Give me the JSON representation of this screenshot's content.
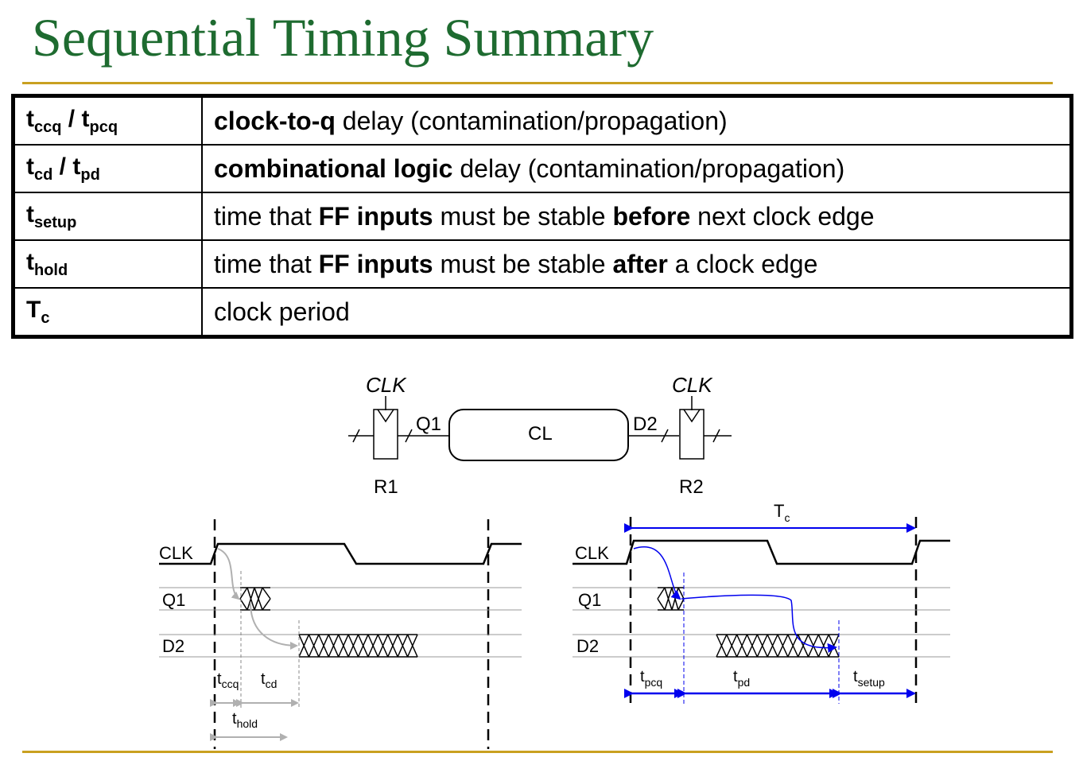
{
  "title": "Sequential Timing Summary",
  "table": {
    "rows": [
      {
        "sym1": "t",
        "sub1": "ccq",
        "sep": " / ",
        "sym2": "t",
        "sub2": "pcq",
        "d1": "",
        "b1": "clock-to-q",
        "d2": " delay (contamination/propagation)",
        "b2": "",
        "d3": ""
      },
      {
        "sym1": "t",
        "sub1": "cd",
        "sep": " / ",
        "sym2": "t",
        "sub2": "pd",
        "d1": "",
        "b1": "combinational logic",
        "d2": " delay (contamination/propagation)",
        "b2": "",
        "d3": ""
      },
      {
        "sym1": "t",
        "sub1": "setup",
        "sep": "",
        "sym2": "",
        "sub2": "",
        "d1": "time that ",
        "b1": "FF inputs",
        "d2": " must be stable ",
        "b2": "before",
        "d3": " next clock edge"
      },
      {
        "sym1": "t",
        "sub1": "hold",
        "sep": "",
        "sym2": "",
        "sub2": "",
        "d1": "time that ",
        "b1": "FF inputs",
        "d2": " must be stable ",
        "b2": "after",
        "d3": " a clock edge"
      },
      {
        "sym1": "T",
        "sub1": "c",
        "sep": "",
        "sym2": "",
        "sub2": "",
        "d1": "clock period",
        "b1": "",
        "d2": "",
        "b2": "",
        "d3": ""
      }
    ]
  },
  "circuit": {
    "clk_left": "CLK",
    "clk_right": "CLK",
    "q1": "Q1",
    "d2": "D2",
    "cl": "CL",
    "r1": "R1",
    "r2": "R2"
  },
  "timing_left": {
    "signals": [
      "CLK",
      "Q1",
      "D2"
    ],
    "tccq": {
      "t": "t",
      "sub": "ccq"
    },
    "tcd": {
      "t": "t",
      "sub": "cd"
    },
    "thold": {
      "t": "t",
      "sub": "hold"
    }
  },
  "timing_right": {
    "signals": [
      "CLK",
      "Q1",
      "D2"
    ],
    "tc": {
      "t": "T",
      "sub": "c"
    },
    "tpcq": {
      "t": "t",
      "sub": "pcq"
    },
    "tpd": {
      "t": "t",
      "sub": "pd"
    },
    "tsetup": {
      "t": "t",
      "sub": "setup"
    }
  },
  "colors": {
    "title": "#1e6b30",
    "rule": "#c9a020",
    "arrow_blue": "#0000ee",
    "arrow_gray": "#b0b0b0"
  }
}
